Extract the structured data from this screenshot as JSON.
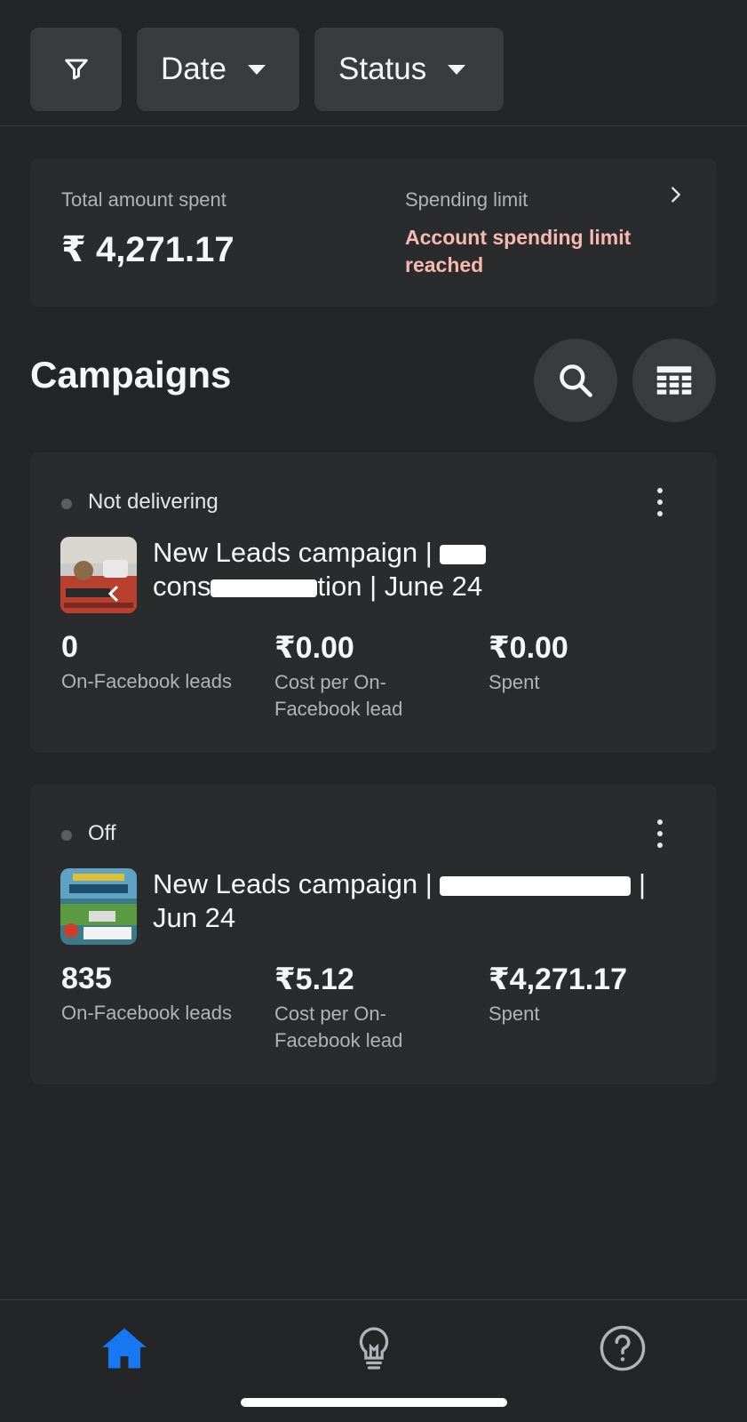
{
  "filters": {
    "filter_icon": "filter-icon",
    "date_label": "Date",
    "status_label": "Status"
  },
  "summary": {
    "total_label": "Total amount spent",
    "total_value": "₹ 4,271.17",
    "limit_label": "Spending limit",
    "limit_status": "Account spending limit reached"
  },
  "campaigns": {
    "title": "Campaigns",
    "items": [
      {
        "status": "Not delivering",
        "name_prefix": "New Leads campaign | ",
        "name_visible": "cons",
        "name_suffix": "tion | June 24",
        "metrics": [
          {
            "value": "0",
            "label": "On-Facebook leads"
          },
          {
            "value": "₹0.00",
            "label": "Cost per On-Facebook lead"
          },
          {
            "value": "₹0.00",
            "label": "Spent"
          }
        ]
      },
      {
        "status": "Off",
        "name_prefix": "New Leads campaign | ",
        "name_suffix": " | Jun 24",
        "metrics": [
          {
            "value": "835",
            "label": "On-Facebook leads"
          },
          {
            "value": "₹5.12",
            "label": "Cost per On-Facebook lead"
          },
          {
            "value": "₹4,271.17",
            "label": "Spent"
          }
        ]
      }
    ]
  },
  "colors": {
    "background": "#242526",
    "card": "#2a2b2c",
    "chip": "#3a3b3c",
    "warning": "#f7b9b0",
    "accent": "#1877f2"
  }
}
